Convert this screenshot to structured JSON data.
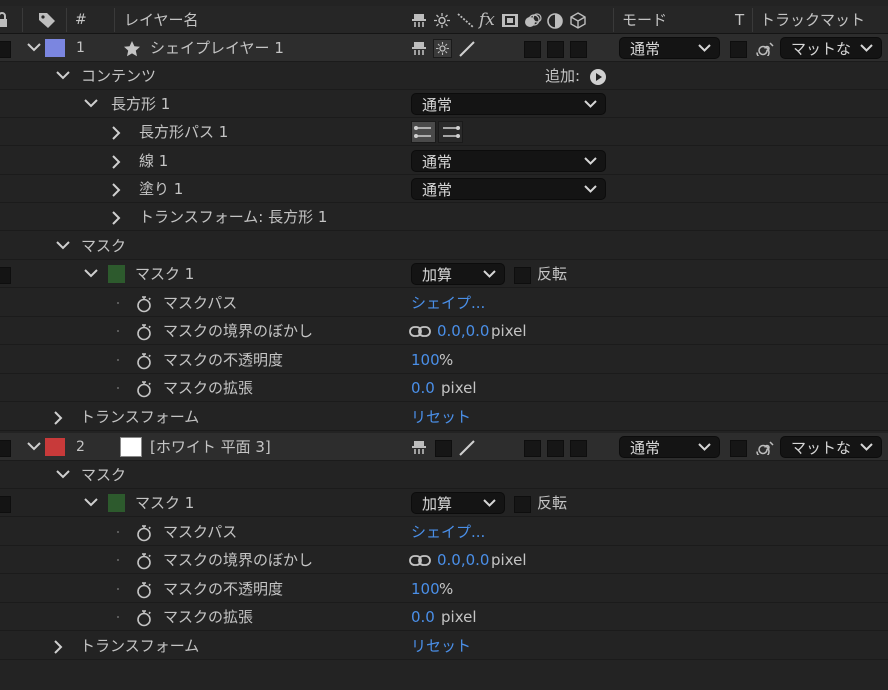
{
  "header": {
    "number_label": "#",
    "name_label": "レイヤー名",
    "mode_label": "モード",
    "t_label": "T",
    "trackmatte_label": "トラックマット"
  },
  "layers": [
    {
      "number": "1",
      "name": "シェイプレイヤー 1",
      "label_color": "#7b86e0",
      "mode": "通常",
      "matte": "マットな"
    },
    {
      "number": "2",
      "name": "[ホワイト 平面 3]",
      "label_color": "#c83a3a",
      "mode": "通常",
      "matte": "マットな"
    }
  ],
  "shape_layer": {
    "contents_label": "コンテンツ",
    "add_label": "追加:",
    "rect_group_label": "長方形 1",
    "rect_group_blend": "通常",
    "rect_path_label": "長方形パス 1",
    "stroke_label": "線 1",
    "stroke_blend": "通常",
    "fill_label": "塗り 1",
    "fill_blend": "通常",
    "rect_transform_label": "トランスフォーム: 長方形 1"
  },
  "masks_1": {
    "group_label": "マスク",
    "mask_name": "マスク 1",
    "mask_color": "#2d5a2d",
    "mode": "加算",
    "invert_label": "反転",
    "path_label": "マスクパス",
    "path_value": "シェイプ...",
    "feather_label": "マスクの境界のぼかし",
    "feather_value": "0.0,0.0",
    "feather_unit": "pixel",
    "opacity_label": "マスクの不透明度",
    "opacity_value": "100",
    "opacity_unit": "%",
    "expansion_label": "マスクの拡張",
    "expansion_value": "0.0",
    "expansion_unit": "pixel",
    "transform_label": "トランスフォーム",
    "reset_label": "リセット"
  },
  "masks_2": {
    "group_label": "マスク",
    "mask_name": "マスク 1",
    "mask_color": "#2d5a2d",
    "mode": "加算",
    "invert_label": "反転",
    "path_label": "マスクパス",
    "path_value": "シェイプ...",
    "feather_label": "マスクの境界のぼかし",
    "feather_value": "0.0,0.0",
    "feather_unit": "pixel",
    "opacity_label": "マスクの不透明度",
    "opacity_value": "100",
    "opacity_unit": "%",
    "expansion_label": "マスクの拡張",
    "expansion_value": "0.0",
    "expansion_unit": "pixel",
    "transform_label": "トランスフォーム",
    "reset_label": "リセット"
  },
  "icons": {
    "lock": "lock-icon",
    "label": "tag-icon",
    "shy": "shy-icon",
    "collapse": "collapse-transform-icon",
    "quality": "quality-icon",
    "effects": "fx-icon",
    "frame_blend": "frame-blend-icon",
    "motion_blur": "motion-blur-icon",
    "adjustment": "adjustment-layer-icon",
    "3d": "3d-layer-icon",
    "stopwatch": "stopwatch-icon",
    "link": "link-icon",
    "play": "play-icon",
    "star": "star-icon",
    "spiral": "pickwhip-icon"
  },
  "colors": {
    "accent_blue": "#4a8fe8",
    "panel_bg": "#232323"
  }
}
